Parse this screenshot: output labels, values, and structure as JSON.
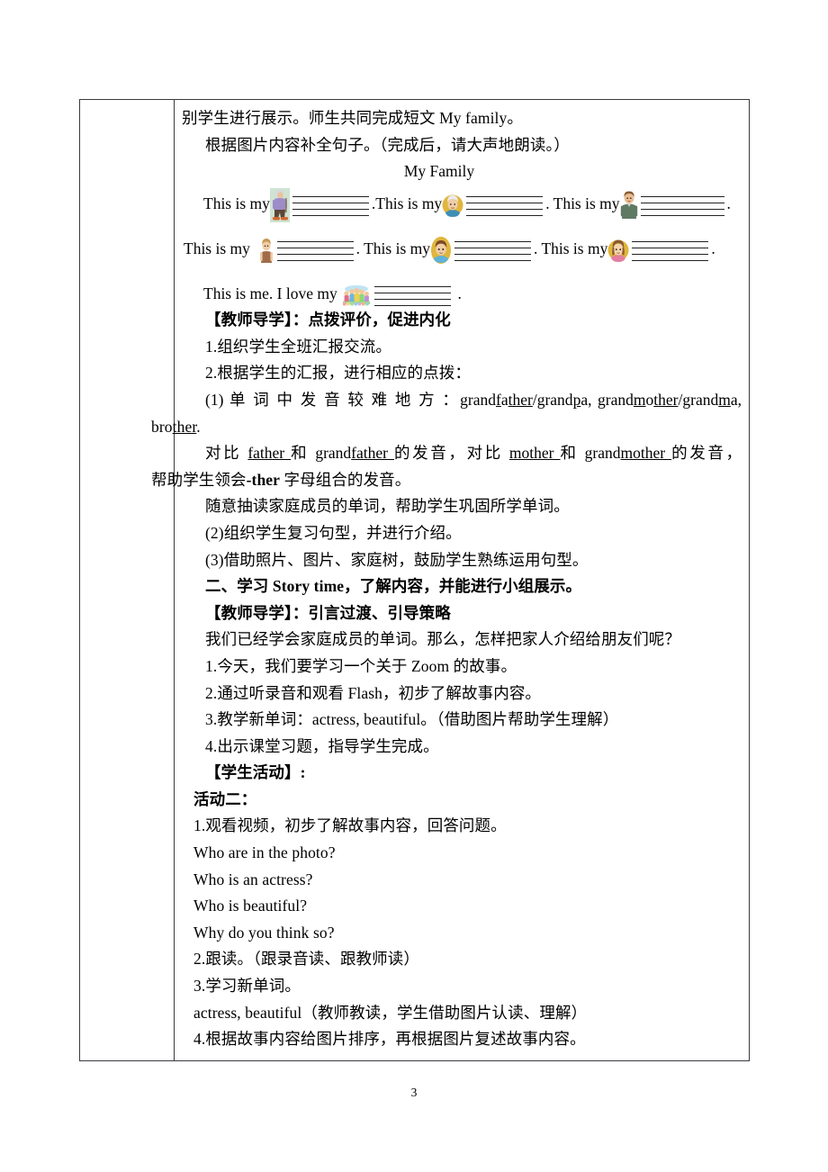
{
  "page": {
    "number": "3"
  },
  "table": {
    "left_column_label": "",
    "rows": [
      {
        "line_intro_1": "别学生进行展示。师生共同完成短文 My family。",
        "line_intro_2": "根据图片内容补全句子。（完成后，请大声地朗读。）",
        "worksheet_title": "My Family",
        "sentence_lead": "This is my",
        "sentence_lead_b": "This is my",
        "self_sentence_a": "This is me. I love my",
        "end_period": ".",
        "figures": [
          {
            "name": "grandfather-figure",
            "alt": "elderly man walking"
          },
          {
            "name": "grandmother-figure",
            "alt": "elderly woman face"
          },
          {
            "name": "father-figure",
            "alt": "man in green jacket"
          },
          {
            "name": "mother-figure",
            "alt": "woman standing"
          },
          {
            "name": "brother-figure",
            "alt": "boy face"
          },
          {
            "name": "sister-figure",
            "alt": "girl face"
          },
          {
            "name": "family-photo-figure",
            "alt": "colorful family group"
          }
        ]
      }
    ]
  },
  "content": {
    "teacher_guide_1_label": "【教师导学】：",
    "teacher_guide_1_text": "点拨评价，促进内化",
    "item_1": "1.组织学生全班汇报交流。",
    "item_2": "2.根据学生的汇报，进行相应的点拨：",
    "item_3_prefix": "(1) 单 词 中 发 音 较 难 地 方 ：",
    "item_3_words": {
      "w1_a": "grand",
      "w1_b": "f",
      "w1_c": "a",
      "w1_d": "ther",
      "w1_sep": "/",
      "w2_a": "grand",
      "w2_b": "p",
      "w2_c": "a",
      "w2_comma": ",",
      "w3_a": "grand",
      "w3_b": "m",
      "w3_c": "o",
      "w3_d": "ther",
      "w3_sep": "/",
      "w4_a": "grand",
      "w4_b": "m",
      "w4_c": "a",
      "w4_comma": ",",
      "w5_a": "bro",
      "w5_b": "ther",
      "w5_period": "."
    },
    "item_4": {
      "p1": "对比 ",
      "father": "father ",
      "p2": "和 ",
      "grand_a": "grand",
      "grand_father": "father ",
      "p3": "的发音，对比 ",
      "mother": "mother ",
      "p4": "和 ",
      "grand_b": "grand",
      "grand_mother": "mother ",
      "p5": "的发音，"
    },
    "item_4b_a": "帮助学生领会",
    "item_4b_b": "-ther",
    "item_4b_c": " 字母组合的发音。",
    "item_5": "随意抽读家庭成员的单词，帮助学生巩固所学单词。",
    "item_6": "(2)组织学生复习句型，并进行介绍。",
    "item_7": "(3)借助照片、图片、家庭树，鼓励学生熟练运用句型。",
    "section_two": "二、学习 Story time，了解内容，并能进行小组展示。",
    "teacher_guide_2_label": "【教师导学】：",
    "teacher_guide_2_text": "引言过渡、引导策略",
    "item_8": "我们已经学会家庭成员的单词。那么，怎样把家人介绍给朋友们呢？",
    "item_9": "1.今天，我们要学习一个关于 Zoom 的故事。",
    "item_10": "2.通过听录音和观看 Flash，初步了解故事内容。",
    "item_11": "3.教学新单词：actress, beautiful。（借助图片帮助学生理解）",
    "item_12": "4.出示课堂习题，指导学生完成。",
    "student_activity_label": "【学生活动】:",
    "activity_two_label": "活动二：",
    "item_13": "1.观看视频，初步了解故事内容，回答问题。",
    "q1": "Who are in the photo?",
    "q2": "Who is an actress?",
    "q3": "Who is beautiful?",
    "q4": "Why do you think so?",
    "item_14": "2.跟读。（跟录音读、跟教师读）",
    "item_15": "3.学习新单词。",
    "item_16": "actress, beautiful（教师教读，学生借助图片认读、理解）",
    "item_17": "4.根据故事内容给图片排序，再根据图片复述故事内容。"
  }
}
